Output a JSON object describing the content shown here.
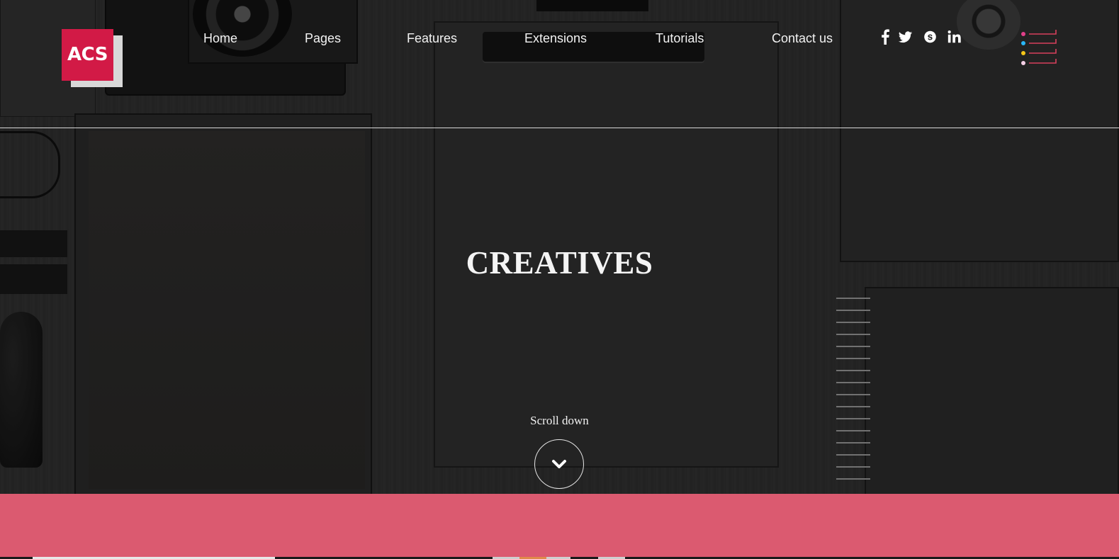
{
  "brand": {
    "logo_text": "ACS",
    "accent": "#d21a46",
    "band_color": "#db5a70"
  },
  "nav": {
    "items": [
      {
        "label": "Home"
      },
      {
        "label": "Pages"
      },
      {
        "label": "Features"
      },
      {
        "label": "Extensions"
      },
      {
        "label": "Tutorials"
      },
      {
        "label": "Contact us"
      }
    ]
  },
  "social": [
    {
      "name": "facebook-icon",
      "glyph": "f"
    },
    {
      "name": "twitter-icon",
      "glyph": "twitter"
    },
    {
      "name": "skype-icon",
      "glyph": "S"
    },
    {
      "name": "linkedin-icon",
      "glyph": "in"
    }
  ],
  "menu_toggle": {
    "dot_colors": [
      "#e0408a",
      "#29b6f6",
      "#f5c518",
      "#f5d0e6"
    ],
    "line_color": "#d8405c"
  },
  "hero": {
    "title": "CREATIVES",
    "scroll_label": "Scroll down"
  }
}
